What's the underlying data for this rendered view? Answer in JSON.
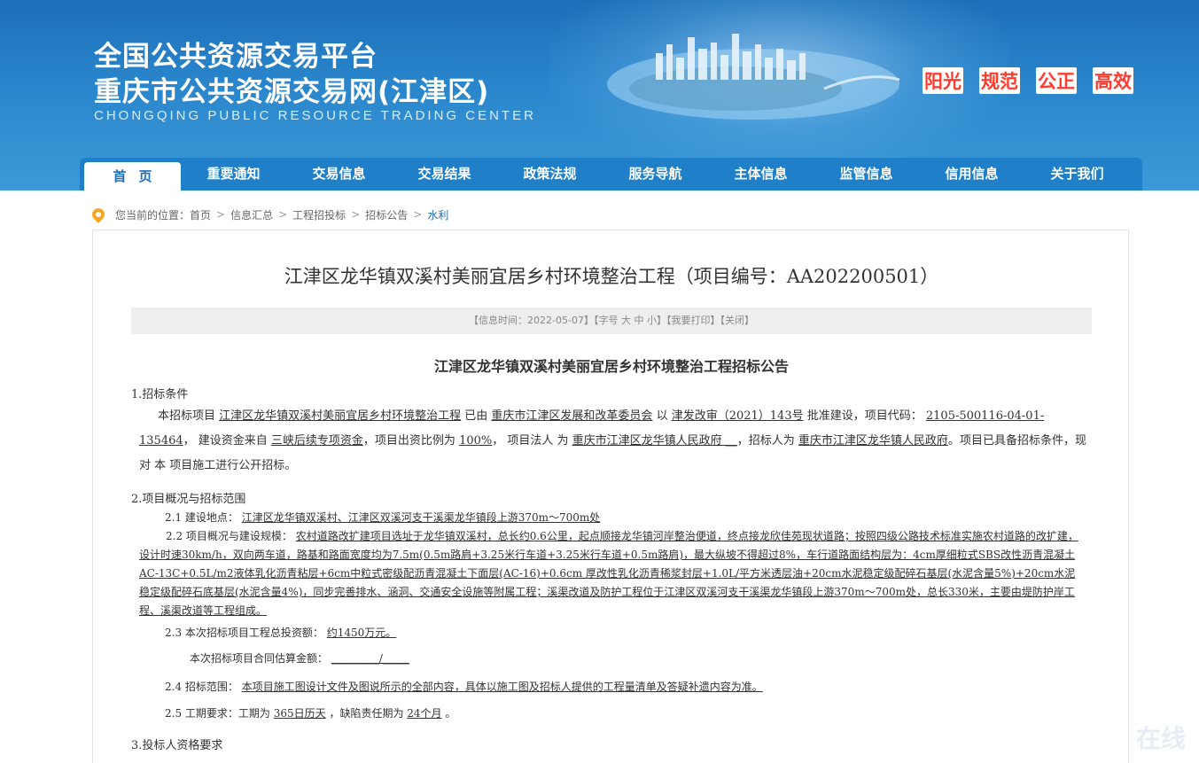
{
  "header": {
    "title_line1": "全国公共资源交易平台",
    "title_line2": "重庆市公共资源交易网(江津区)",
    "title_en": "CHONGQING PUBLIC RESOURCE TRADING CENTER",
    "slogans": [
      "阳光",
      "规范",
      "公正",
      "高效"
    ]
  },
  "nav": {
    "items": [
      "首页",
      "重要通知",
      "交易信息",
      "交易结果",
      "政策法规",
      "服务导航",
      "主体信息",
      "监管信息",
      "信用信息",
      "关于我们"
    ]
  },
  "breadcrumb": {
    "prefix": "您当前的位置：",
    "items": [
      "首页",
      "信息汇总",
      "工程招投标",
      "招标公告",
      "水利"
    ]
  },
  "article": {
    "title": "江津区龙华镇双溪村美丽宜居乡村环境整治工程（项目编号：AA202200501）",
    "info_time": "【信息时间：2022-05-07】",
    "font_label": "【字号",
    "font_large": "大",
    "font_medium": "中",
    "font_small": "小】",
    "print": "【我要打印】",
    "close": "【关闭】",
    "notice_title": "江津区龙华镇双溪村美丽宜居乡村环境整治工程招标公告",
    "s1_heading": "1.招标条件",
    "s1_text": {
      "a": "本招标项目 ",
      "project": "江津区龙华镇双溪村美丽宜居乡村环境整治工程",
      "b": " 已由 ",
      "approver": "重庆市江津区发展和改革委员会",
      "c": " 以 ",
      "doc_no": "津发改审（2021）143号",
      "d": " 批准建设，项目代码： ",
      "code1": "2105-500116-04-01-",
      "code2": "135464",
      "e": "， 建设资金来自 ",
      "fund": "三峡后续专项资金",
      "f": "，项目出资比例为 ",
      "ratio": "100%",
      "g": "， 项目法人 为 ",
      "legal": "重庆市江津区龙华镇人民政府 __",
      "h": "，招标人为 ",
      "tenderer": "重庆市江津区龙华镇人民政府",
      "i": "。项目已具备招",
      "j": "标条件，现对 本 项目施工进行公开招标。"
    },
    "s2_heading": "2.项目概况与招标范围",
    "s2_1_label": "2.1 建设地点：",
    "s2_1_value": "江津区龙华镇双溪村、江津区双溪河支干溪渠龙华镇段上游370m～700m处",
    "s2_2_label": "2.2 项目概况与建设规模：",
    "s2_2_value": "农村道路改扩建项目选址于龙华镇双溪村，总长约0.6公里，起点顺接龙华镇河岸整治便道，终点接龙欣佳苑现状道路；按照四级公路技术标准实施农村道路的改扩建，设计时速30km/h，双向两车道，路基和路面宽度均为7.5m(0.5m路肩+3.25米行车道+3.25米行车道+0.5m路肩)，最大纵坡不得超过8%，车行道路面结构层为：4cm厚细粒式SBS改性沥青混凝土AC-13C+0.5L/m2液体乳化沥青粘层+6cm中粒式密级配沥青混凝土下面层(AC-16)+0.6cm 厚改性乳化沥青稀浆封层+1.0L/平方米透层油+20cm水泥稳定级配碎石基层(水泥含量5%)+20cm水泥稳定级配碎石底基层(水泥含量4%)，同步完善排水、涵洞、交通安全设施等附属工程；溪渠改道及防护工程位于江津区双溪河支干溪渠龙华镇段上游370m～700m处，总长330米，主要由堤防护岸工程、溪渠改道等工程组成。",
    "s2_3_label": "2.3 本次招标项目工程总投资额：",
    "s2_3_value": "约1450万元。",
    "s2_3b_label": "本次招标项目合同估算金额：",
    "s2_3b_value": "_________/_____",
    "s2_4_label": "2.4 招标范围：",
    "s2_4_value": "本项目施工图设计文件及图说所示的全部内容，具体以施工图及招标人提供的工程量清单及答疑补遗内容为准。",
    "s2_5_label": "2.5 工期要求：工期为 ",
    "s2_5_days": "365日历天",
    "s2_5_mid": "  ，缺陷责任期为 ",
    "s2_5_months": "24个月",
    "s2_5_end": " 。",
    "s3_heading": "3.投标人资格要求"
  },
  "watermark": "在线"
}
